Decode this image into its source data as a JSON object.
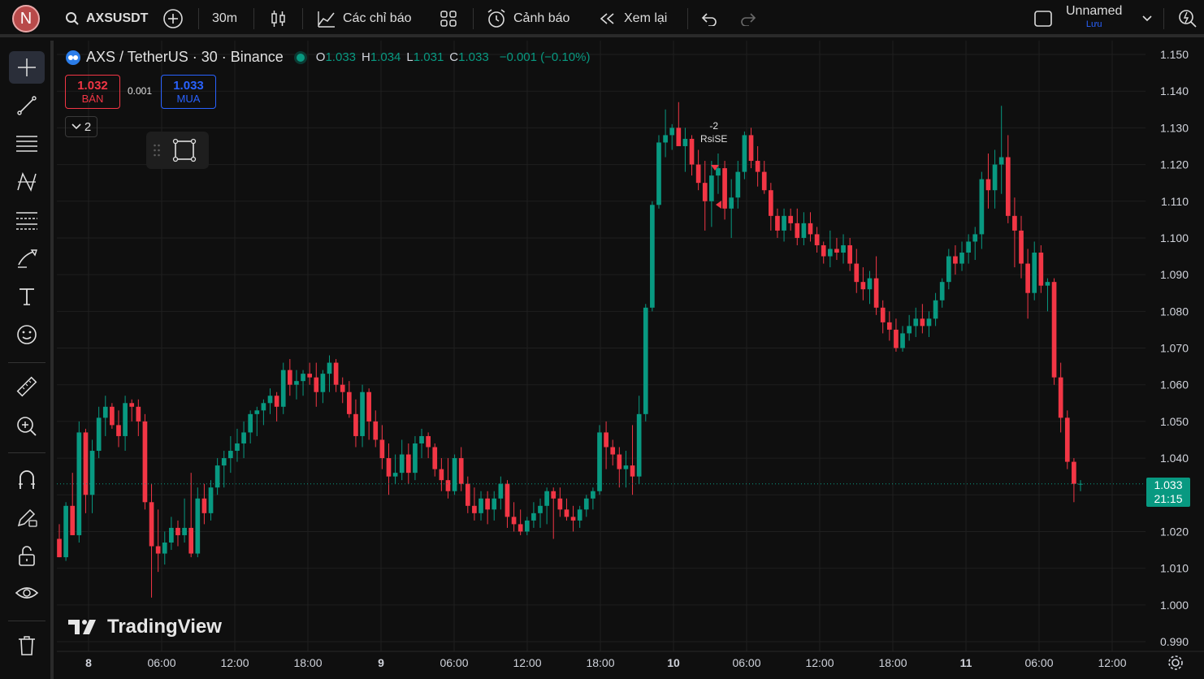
{
  "topbar": {
    "avatar_letter": "N",
    "symbol": "AXSUSDT",
    "interval": "30m",
    "indicators_label": "Các chỉ báo",
    "alerts_label": "Cảnh báo",
    "replay_label": "Xem lại",
    "layout_name": "Unnamed",
    "save_label": "Lưu"
  },
  "legend": {
    "title": "AXS / TetherUS · 30 · Binance",
    "o_label": "O",
    "o": "1.033",
    "h_label": "H",
    "h": "1.034",
    "l_label": "L",
    "l": "1.031",
    "c_label": "C",
    "c": "1.033",
    "change": "−0.001 (−0.10%)"
  },
  "trade": {
    "sell_price": "1.032",
    "sell_label": "BÁN",
    "spread": "0.001",
    "buy_price": "1.033",
    "buy_label": "MUA"
  },
  "collapse_count": "2",
  "annotation": {
    "line1": "-2",
    "line2": "RsiSE"
  },
  "last_price": {
    "price": "1.033",
    "countdown": "21:15"
  },
  "brand": "TradingView",
  "colors": {
    "up": "#089981",
    "down": "#f23645",
    "accent": "#2962ff",
    "background": "#0f0f0f"
  },
  "chart_data": {
    "type": "candlestick",
    "y_axis_ticks": [
      "1.150",
      "1.140",
      "1.130",
      "1.120",
      "1.110",
      "1.100",
      "1.090",
      "1.080",
      "1.070",
      "1.060",
      "1.050",
      "1.040",
      "1.030",
      "1.020",
      "1.010",
      "1.000",
      "0.990"
    ],
    "x_axis_ticks": [
      "8",
      "06:00",
      "12:00",
      "18:00",
      "9",
      "06:00",
      "12:00",
      "18:00",
      "10",
      "06:00",
      "12:00",
      "18:00",
      "11",
      "06:00",
      "12:00"
    ],
    "ylim": [
      0.988,
      1.152
    ],
    "grid": true,
    "candles": [
      [
        1.018,
        1.022,
        1.013,
        1.013
      ],
      [
        1.013,
        1.028,
        1.012,
        1.027
      ],
      [
        1.027,
        1.036,
        1.019,
        1.019
      ],
      [
        1.019,
        1.05,
        1.017,
        1.047
      ],
      [
        1.047,
        1.048,
        1.025,
        1.03
      ],
      [
        1.03,
        1.045,
        1.025,
        1.042
      ],
      [
        1.042,
        1.054,
        1.04,
        1.051
      ],
      [
        1.051,
        1.057,
        1.046,
        1.054
      ],
      [
        1.054,
        1.055,
        1.048,
        1.049
      ],
      [
        1.049,
        1.053,
        1.043,
        1.046
      ],
      [
        1.046,
        1.057,
        1.042,
        1.055
      ],
      [
        1.055,
        1.056,
        1.05,
        1.054
      ],
      [
        1.054,
        1.056,
        1.046,
        1.05
      ],
      [
        1.05,
        1.052,
        1.026,
        1.028
      ],
      [
        1.028,
        1.033,
        1.002,
        1.016
      ],
      [
        1.016,
        1.026,
        1.009,
        1.014
      ],
      [
        1.014,
        1.02,
        1.011,
        1.017
      ],
      [
        1.017,
        1.024,
        1.015,
        1.021
      ],
      [
        1.021,
        1.023,
        1.016,
        1.019
      ],
      [
        1.019,
        1.029,
        1.017,
        1.021
      ],
      [
        1.021,
        1.036,
        1.013,
        1.014
      ],
      [
        1.014,
        1.032,
        1.013,
        1.029
      ],
      [
        1.029,
        1.033,
        1.022,
        1.025
      ],
      [
        1.025,
        1.034,
        1.023,
        1.032
      ],
      [
        1.032,
        1.04,
        1.03,
        1.038
      ],
      [
        1.038,
        1.042,
        1.032,
        1.04
      ],
      [
        1.04,
        1.046,
        1.036,
        1.042
      ],
      [
        1.042,
        1.048,
        1.039,
        1.044
      ],
      [
        1.044,
        1.05,
        1.04,
        1.047
      ],
      [
        1.047,
        1.053,
        1.044,
        1.052
      ],
      [
        1.052,
        1.054,
        1.046,
        1.053
      ],
      [
        1.053,
        1.056,
        1.049,
        1.055
      ],
      [
        1.055,
        1.059,
        1.052,
        1.057
      ],
      [
        1.057,
        1.058,
        1.05,
        1.054
      ],
      [
        1.054,
        1.066,
        1.052,
        1.064
      ],
      [
        1.064,
        1.067,
        1.057,
        1.06
      ],
      [
        1.06,
        1.064,
        1.056,
        1.061
      ],
      [
        1.061,
        1.064,
        1.057,
        1.063
      ],
      [
        1.063,
        1.066,
        1.06,
        1.062
      ],
      [
        1.062,
        1.066,
        1.054,
        1.058
      ],
      [
        1.058,
        1.064,
        1.055,
        1.063
      ],
      [
        1.063,
        1.068,
        1.058,
        1.066
      ],
      [
        1.066,
        1.067,
        1.058,
        1.06
      ],
      [
        1.06,
        1.062,
        1.055,
        1.058
      ],
      [
        1.058,
        1.061,
        1.051,
        1.052
      ],
      [
        1.052,
        1.056,
        1.043,
        1.046
      ],
      [
        1.046,
        1.06,
        1.043,
        1.058
      ],
      [
        1.058,
        1.059,
        1.045,
        1.05
      ],
      [
        1.05,
        1.053,
        1.043,
        1.045
      ],
      [
        1.045,
        1.049,
        1.037,
        1.04
      ],
      [
        1.04,
        1.044,
        1.03,
        1.035
      ],
      [
        1.035,
        1.041,
        1.033,
        1.036
      ],
      [
        1.036,
        1.045,
        1.034,
        1.041
      ],
      [
        1.041,
        1.044,
        1.033,
        1.036
      ],
      [
        1.036,
        1.046,
        1.034,
        1.044
      ],
      [
        1.044,
        1.048,
        1.04,
        1.046
      ],
      [
        1.046,
        1.047,
        1.04,
        1.043
      ],
      [
        1.043,
        1.044,
        1.035,
        1.037
      ],
      [
        1.037,
        1.04,
        1.031,
        1.034
      ],
      [
        1.034,
        1.04,
        1.029,
        1.031
      ],
      [
        1.031,
        1.041,
        1.03,
        1.04
      ],
      [
        1.04,
        1.043,
        1.031,
        1.033
      ],
      [
        1.033,
        1.035,
        1.025,
        1.027
      ],
      [
        1.027,
        1.032,
        1.023,
        1.025
      ],
      [
        1.025,
        1.031,
        1.023,
        1.029
      ],
      [
        1.029,
        1.031,
        1.022,
        1.026
      ],
      [
        1.026,
        1.031,
        1.023,
        1.029
      ],
      [
        1.029,
        1.035,
        1.026,
        1.033
      ],
      [
        1.033,
        1.034,
        1.021,
        1.024
      ],
      [
        1.024,
        1.028,
        1.02,
        1.022
      ],
      [
        1.022,
        1.026,
        1.019,
        1.02
      ],
      [
        1.02,
        1.024,
        1.019,
        1.023
      ],
      [
        1.023,
        1.028,
        1.021,
        1.025
      ],
      [
        1.025,
        1.029,
        1.021,
        1.027
      ],
      [
        1.027,
        1.032,
        1.022,
        1.031
      ],
      [
        1.031,
        1.032,
        1.018,
        1.029
      ],
      [
        1.029,
        1.032,
        1.024,
        1.026
      ],
      [
        1.026,
        1.029,
        1.023,
        1.024
      ],
      [
        1.024,
        1.027,
        1.02,
        1.023
      ],
      [
        1.023,
        1.027,
        1.021,
        1.026
      ],
      [
        1.026,
        1.03,
        1.024,
        1.029
      ],
      [
        1.029,
        1.032,
        1.026,
        1.031
      ],
      [
        1.031,
        1.049,
        1.03,
        1.047
      ],
      [
        1.047,
        1.05,
        1.037,
        1.043
      ],
      [
        1.043,
        1.045,
        1.038,
        1.041
      ],
      [
        1.041,
        1.043,
        1.032,
        1.037
      ],
      [
        1.037,
        1.042,
        1.032,
        1.038
      ],
      [
        1.038,
        1.049,
        1.03,
        1.035
      ],
      [
        1.035,
        1.057,
        1.033,
        1.052
      ],
      [
        1.052,
        1.082,
        1.05,
        1.081
      ],
      [
        1.081,
        1.11,
        1.08,
        1.109
      ],
      [
        1.109,
        1.128,
        1.108,
        1.126
      ],
      [
        1.126,
        1.135,
        1.122,
        1.128
      ],
      [
        1.128,
        1.131,
        1.124,
        1.13
      ],
      [
        1.13,
        1.137,
        1.126,
        1.125
      ],
      [
        1.125,
        1.13,
        1.118,
        1.127
      ],
      [
        1.127,
        1.128,
        1.117,
        1.12
      ],
      [
        1.12,
        1.124,
        1.113,
        1.115
      ],
      [
        1.115,
        1.121,
        1.102,
        1.11
      ],
      [
        1.11,
        1.121,
        1.103,
        1.117
      ],
      [
        1.117,
        1.123,
        1.112,
        1.119
      ],
      [
        1.119,
        1.121,
        1.105,
        1.108
      ],
      [
        1.108,
        1.116,
        1.1,
        1.111
      ],
      [
        1.111,
        1.121,
        1.108,
        1.118
      ],
      [
        1.118,
        1.129,
        1.116,
        1.128
      ],
      [
        1.128,
        1.13,
        1.119,
        1.121
      ],
      [
        1.121,
        1.125,
        1.114,
        1.118
      ],
      [
        1.118,
        1.121,
        1.112,
        1.113
      ],
      [
        1.113,
        1.115,
        1.102,
        1.106
      ],
      [
        1.106,
        1.108,
        1.1,
        1.102
      ],
      [
        1.102,
        1.108,
        1.099,
        1.106
      ],
      [
        1.106,
        1.108,
        1.102,
        1.104
      ],
      [
        1.104,
        1.108,
        1.098,
        1.1
      ],
      [
        1.1,
        1.107,
        1.098,
        1.104
      ],
      [
        1.104,
        1.107,
        1.099,
        1.101
      ],
      [
        1.101,
        1.103,
        1.096,
        1.098
      ],
      [
        1.098,
        1.099,
        1.093,
        1.095
      ],
      [
        1.095,
        1.102,
        1.092,
        1.097
      ],
      [
        1.097,
        1.1,
        1.094,
        1.096
      ],
      [
        1.096,
        1.101,
        1.093,
        1.098
      ],
      [
        1.098,
        1.1,
        1.091,
        1.093
      ],
      [
        1.093,
        1.097,
        1.085,
        1.088
      ],
      [
        1.088,
        1.092,
        1.083,
        1.086
      ],
      [
        1.086,
        1.091,
        1.082,
        1.089
      ],
      [
        1.089,
        1.095,
        1.079,
        1.081
      ],
      [
        1.081,
        1.083,
        1.074,
        1.077
      ],
      [
        1.077,
        1.08,
        1.072,
        1.075
      ],
      [
        1.075,
        1.078,
        1.069,
        1.07
      ],
      [
        1.07,
        1.076,
        1.069,
        1.074
      ],
      [
        1.074,
        1.079,
        1.072,
        1.076
      ],
      [
        1.076,
        1.081,
        1.073,
        1.078
      ],
      [
        1.078,
        1.082,
        1.074,
        1.076
      ],
      [
        1.076,
        1.08,
        1.073,
        1.078
      ],
      [
        1.078,
        1.085,
        1.076,
        1.083
      ],
      [
        1.083,
        1.089,
        1.081,
        1.088
      ],
      [
        1.088,
        1.097,
        1.086,
        1.095
      ],
      [
        1.095,
        1.098,
        1.09,
        1.093
      ],
      [
        1.093,
        1.099,
        1.091,
        1.096
      ],
      [
        1.096,
        1.101,
        1.093,
        1.099
      ],
      [
        1.099,
        1.103,
        1.094,
        1.101
      ],
      [
        1.101,
        1.118,
        1.097,
        1.116
      ],
      [
        1.116,
        1.123,
        1.108,
        1.113
      ],
      [
        1.113,
        1.124,
        1.108,
        1.12
      ],
      [
        1.12,
        1.136,
        1.112,
        1.122
      ],
      [
        1.122,
        1.128,
        1.104,
        1.106
      ],
      [
        1.106,
        1.111,
        1.092,
        1.102
      ],
      [
        1.102,
        1.106,
        1.089,
        1.093
      ],
      [
        1.093,
        1.097,
        1.078,
        1.085
      ],
      [
        1.085,
        1.099,
        1.083,
        1.096
      ],
      [
        1.096,
        1.098,
        1.085,
        1.087
      ],
      [
        1.087,
        1.089,
        1.08,
        1.088
      ],
      [
        1.088,
        1.089,
        1.06,
        1.062
      ],
      [
        1.062,
        1.066,
        1.047,
        1.051
      ],
      [
        1.051,
        1.053,
        1.037,
        1.039
      ],
      [
        1.039,
        1.04,
        1.028,
        1.033
      ],
      [
        1.033,
        1.034,
        1.031,
        1.033
      ]
    ]
  }
}
